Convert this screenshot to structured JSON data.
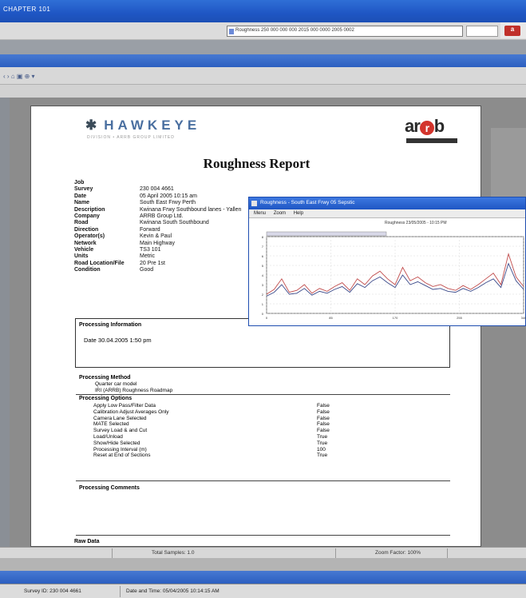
{
  "window": {
    "title": "CHAPTER 101",
    "address": "Roughness 250 000 000 000 2015 000 0000 2005 0002"
  },
  "toolbar": {
    "nav_buttons": "‹  ›  ⌂   ▣  ⊕ ▾"
  },
  "report": {
    "logo_text": "HAWKEYE",
    "logo_mark": "✱",
    "logo_subtitle": "DIVISION • ARRB GROUP LIMITED",
    "brand": "arrb",
    "title": "Roughness Report",
    "fields": [
      {
        "key": "Job",
        "value": ""
      },
      {
        "key": "Survey",
        "value": "230 004 4661"
      },
      {
        "key": "Date",
        "value": "05 April 2005 10:15 am"
      },
      {
        "key": "Name",
        "value": "South East Frwy Perth"
      },
      {
        "key": "Description",
        "value": "Kwinana Frwy Southbound lanes - Yallen"
      },
      {
        "key": "Company",
        "value": "ARRB Group Ltd."
      },
      {
        "key": "Road",
        "value": "Kwinana South Southbound"
      },
      {
        "key": "Direction",
        "value": "Forward"
      },
      {
        "key": "Operator(s)",
        "value": "Kevin & Paul"
      },
      {
        "key": "Network",
        "value": "Main Highway"
      },
      {
        "key": "Vehicle",
        "value": "TS3 101"
      },
      {
        "key": "Units",
        "value": "Metric"
      },
      {
        "key": "Road Location/File",
        "value": "20 Pre 1st"
      },
      {
        "key": "Condition",
        "value": "Good"
      }
    ],
    "processing_info_heading": "Processing Information",
    "processing_date": "Date   30.04.2005  1:50 pm",
    "processing_method_heading": "Processing Method",
    "processing_method_lines": [
      "Quarter car model",
      "IRI (ARRB) Roughness Roadmap"
    ],
    "processing_options_heading": "Processing Options",
    "processing_options": [
      {
        "key": "Apply Low Pass/Filter Data",
        "value": "False"
      },
      {
        "key": "Calibration Adjust Averages Only",
        "value": "False"
      },
      {
        "key": "Camera Lane Selected",
        "value": "False"
      },
      {
        "key": "MATE Selected",
        "value": "False"
      },
      {
        "key": "Survey Load & and Cut",
        "value": "False"
      },
      {
        "key": "Load/Unload",
        "value": "True"
      },
      {
        "key": "Show/Hide Selected",
        "value": "True"
      },
      {
        "key": "Processing Interval (m)",
        "value": "100"
      },
      {
        "key": "Reset at End of Sections",
        "value": "True"
      }
    ],
    "processing_comments_heading": "Processing Comments",
    "footer_heading": "Raw Data"
  },
  "popup": {
    "title": "Roughness - South East Frwy 05 Sepstic",
    "menu": [
      "Menu",
      "Zoom",
      "Help"
    ],
    "chart_caption": "Roughness 23/05/2005 - 10:15 PM"
  },
  "chart_data": {
    "type": "line",
    "x": [
      0,
      10,
      20,
      30,
      40,
      50,
      60,
      70,
      80,
      90,
      100,
      110,
      120,
      130,
      140,
      150,
      160,
      170,
      180,
      190,
      200,
      210,
      220,
      230,
      240,
      250,
      260,
      270,
      280,
      290,
      300,
      310,
      320,
      330,
      340
    ],
    "series": [
      {
        "name": "",
        "color": "#c14b4b",
        "values": [
          2.0,
          2.5,
          3.6,
          2.2,
          2.4,
          3.0,
          2.1,
          2.6,
          2.3,
          2.8,
          3.2,
          2.4,
          3.6,
          3.0,
          3.9,
          4.4,
          3.6,
          3.0,
          4.8,
          3.4,
          3.8,
          3.2,
          2.8,
          3.0,
          2.6,
          2.4,
          2.9,
          2.5,
          3.0,
          3.6,
          4.2,
          3.0,
          6.2,
          3.8,
          2.8
        ]
      },
      {
        "name": "",
        "color": "#3b4a8a",
        "values": [
          1.8,
          2.2,
          3.0,
          2.0,
          2.1,
          2.6,
          1.9,
          2.3,
          2.1,
          2.5,
          2.8,
          2.2,
          3.1,
          2.7,
          3.4,
          3.8,
          3.2,
          2.7,
          4.0,
          3.0,
          3.3,
          2.9,
          2.5,
          2.6,
          2.3,
          2.2,
          2.6,
          2.3,
          2.7,
          3.2,
          3.6,
          2.7,
          5.2,
          3.4,
          2.5
        ]
      }
    ],
    "ylim": [
      0,
      8
    ],
    "xlim": [
      0,
      340
    ],
    "grid": true
  },
  "status": {
    "total_samples": "Total Samples: 1.0",
    "zoom_factor": "Zoom Factor: 100%",
    "survey_id": "Survey ID: 230 004 4661",
    "date_time": "Date and Time: 05/04/2005 10:14:15 AM"
  }
}
